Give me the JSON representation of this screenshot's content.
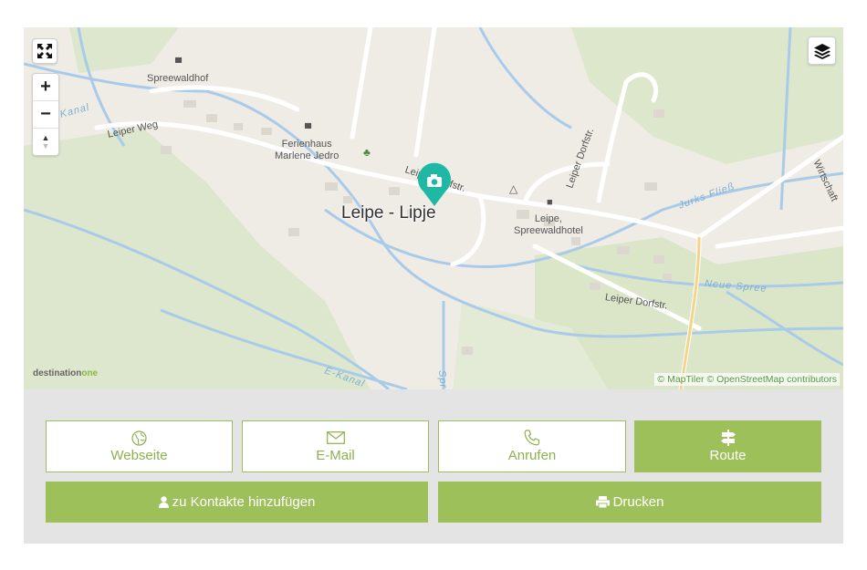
{
  "map": {
    "place_label": "Leipe - Lipje",
    "attribution": "© MapTiler © OpenStreetMap contributors",
    "brand_text": "destination",
    "brand_accent": "one",
    "fullscreen_icon": "expand-icon",
    "layers_icon": "layers-icon",
    "zoom_in_label": "+",
    "zoom_out_label": "−",
    "compass_label": "▲▼",
    "labels": {
      "spreewaldhof": "Spreewaldhof",
      "ferienhaus": "Ferienhaus\nMarlene Jedro",
      "leipe_hotel": "Leipe,\nSpreewaldhotel",
      "leiper_weg": "Leiper Weg",
      "dorfstr1": "Leiper Dorfstr.",
      "dorfstr2": "Leiper Dorfstr.",
      "dorfstr3": "Leiper Dorfstr.",
      "wirtschaft": "Wirtschaft",
      "jurks_fliess": "Jurks Fließ",
      "neue_spree": "Neue Spree",
      "e_kanal": "E-Kanal",
      "kanal": "Kanal",
      "spr": "Spr"
    },
    "marker_icon": "camera-icon",
    "colors": {
      "marker": "#1fb8a4",
      "water": "#a9cbe9",
      "green": "#d9e6c8",
      "road": "#ffffff"
    }
  },
  "buttons": {
    "website": "Webseite",
    "email": "E-Mail",
    "call": "Anrufen",
    "route": "Route",
    "contacts": "zu Kontakte hinzufügen",
    "print": "Drucken"
  },
  "colors": {
    "accent": "#9dc05b",
    "panel": "#e4e4e4"
  }
}
